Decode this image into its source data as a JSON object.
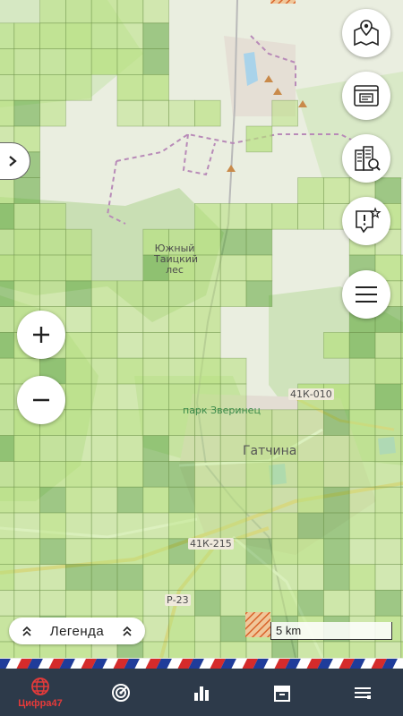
{
  "map": {
    "labels": {
      "forest_line1": "Южный",
      "forest_line2": "Таицкий",
      "forest_line3": "лес",
      "park": "парк Зверинец",
      "town": "Гатчина",
      "road1": "41К-010",
      "road2": "41К-215",
      "road3": "Р-23"
    },
    "scale_label": "5 km"
  },
  "legend": {
    "label": "Легенда"
  },
  "fab_buttons": [
    {
      "icon": "map-pin-icon"
    },
    {
      "icon": "document-window-icon"
    },
    {
      "icon": "buildings-search-icon"
    },
    {
      "icon": "location-star-icon"
    },
    {
      "icon": "menu-icon"
    }
  ],
  "nav": {
    "items": [
      {
        "label": "Цифра47",
        "icon": "globe-icon",
        "active": true
      },
      {
        "label": "",
        "icon": "radar-icon",
        "active": false
      },
      {
        "label": "",
        "icon": "bar-chart-icon",
        "active": false
      },
      {
        "label": "",
        "icon": "archive-box-icon",
        "active": false
      },
      {
        "label": "",
        "icon": "list-icon",
        "active": false
      }
    ]
  },
  "colors": {
    "accent": "#e53a3a",
    "navbar": "#2d3a4a",
    "cell_light": "#b5e07a",
    "cell_dark": "#5fa83a"
  }
}
